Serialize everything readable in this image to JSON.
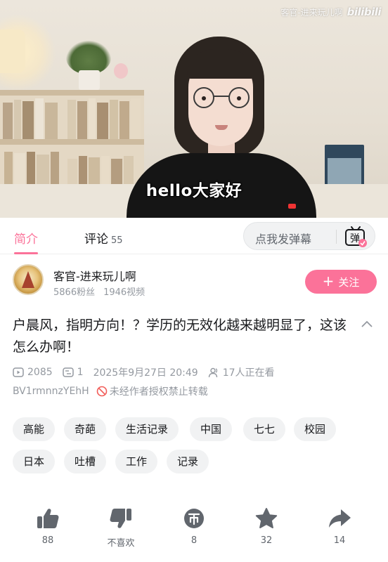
{
  "video": {
    "watermark_text": "客官-进来玩儿啊",
    "watermark_logo": "bilibili",
    "subtitle": "hello大家好"
  },
  "tabs": {
    "intro": "简介",
    "comments": "评论",
    "comments_count": "55",
    "danmaku_placeholder": "点我发弹幕",
    "danmaku_icon_text": "弹"
  },
  "uploader": {
    "name": "客官-进来玩儿啊",
    "fans": "5866粉丝",
    "videos": "1946视频",
    "follow_label": "关注"
  },
  "video_info": {
    "title": "户晨风，指明方向！？学历的无效化越来越明显了，这该怎么办啊！",
    "plays": "2085",
    "danmaku_count": "1",
    "date": "2025年9月27日 20:49",
    "watching": "17人正在看",
    "bvid": "BV1rmnnzYEhH",
    "no_repost": "未经作者授权禁止转载"
  },
  "tags": [
    "高能",
    "奇葩",
    "生活记录",
    "中国",
    "七七",
    "校园",
    "日本",
    "吐槽",
    "工作",
    "记录"
  ],
  "actions": {
    "like": "88",
    "dislike": "不喜欢",
    "coin": "8",
    "favorite": "32",
    "share": "14"
  },
  "colors": {
    "accent": "#fb7299",
    "muted": "#9499a0",
    "icon": "#61666d"
  }
}
